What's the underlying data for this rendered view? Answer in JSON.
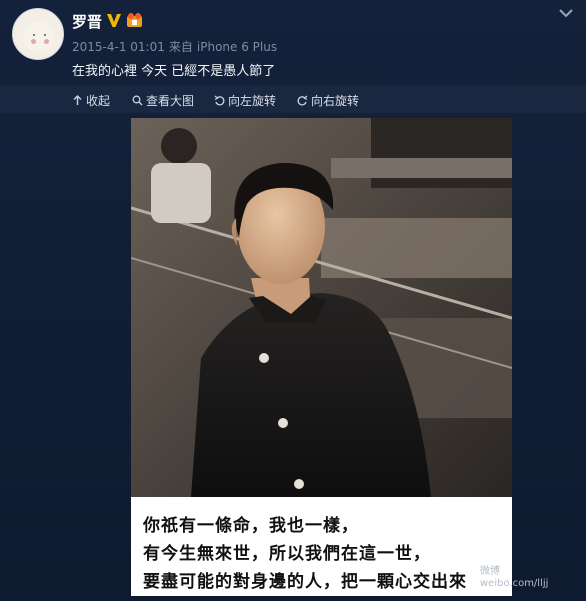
{
  "post": {
    "username": "罗晋",
    "timestamp": "2015-4-1 01:01",
    "source_prefix": "来自",
    "source": "iPhone 6 Plus",
    "text": "在我的心裡 今天 已經不是愚人節了"
  },
  "toolbar": {
    "collapse": "收起",
    "view_large": "查看大图",
    "rotate_left": "向左旋转",
    "rotate_right": "向右旋转"
  },
  "image": {
    "caption_lines": [
      "你祇有一條命，我也一樣，",
      "有今生無來世，所以我們在這一世，",
      "要盡可能的對身邊的人，把一顆心交出來"
    ],
    "watermark_line1": "微博",
    "watermark_line2": "weibo.com/lljj"
  },
  "colors": {
    "background": "#0f1a2e",
    "verified": "#f2b705",
    "text": "#e8edf5",
    "meta": "#7f8aa0"
  },
  "icons": [
    "verified-icon",
    "vip-badge-icon",
    "chevron-down-icon",
    "collapse-icon",
    "search-icon",
    "rotate-left-icon",
    "rotate-right-icon"
  ]
}
